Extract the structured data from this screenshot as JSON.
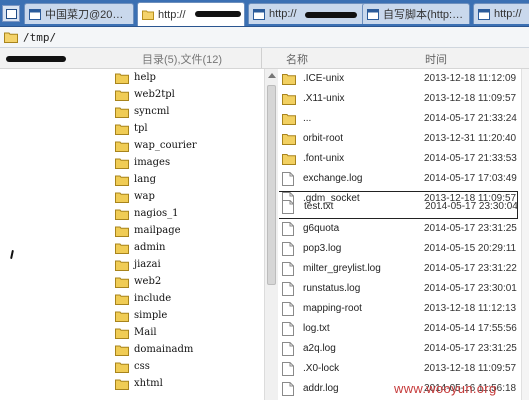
{
  "tabs": [
    {
      "label": "中国菜刀@20…",
      "active": false,
      "icon": "app-window-icon"
    },
    {
      "label": "http://",
      "active": true,
      "icon": "folder-icon"
    },
    {
      "label": "http://",
      "active": false,
      "icon": "app-window-icon"
    },
    {
      "label": "自写脚本(http:…",
      "active": false,
      "icon": "app-window-icon"
    },
    {
      "label": "http://",
      "active": false,
      "icon": "app-window-icon"
    }
  ],
  "path": {
    "value": "/tmp/"
  },
  "header": {
    "dir_count": "目录(5),文件(12)",
    "col_name": "名称",
    "col_time": "时间"
  },
  "tree": [
    {
      "label": "help"
    },
    {
      "label": "web2tpl"
    },
    {
      "label": "syncml"
    },
    {
      "label": "tpl"
    },
    {
      "label": "wap_courier"
    },
    {
      "label": "images"
    },
    {
      "label": "lang"
    },
    {
      "label": "wap"
    },
    {
      "label": "nagios_1"
    },
    {
      "label": "mailpage"
    },
    {
      "label": "admin"
    },
    {
      "label": "jiazai"
    },
    {
      "label": "web2"
    },
    {
      "label": "include"
    },
    {
      "label": "simple"
    },
    {
      "label": "Mail"
    },
    {
      "label": "domainadm"
    },
    {
      "label": "css"
    },
    {
      "label": "xhtml"
    }
  ],
  "files": [
    {
      "name": ".ICE-unix",
      "time": "2013-12-18 11:12:09",
      "type": "folder"
    },
    {
      "name": ".X11-unix",
      "time": "2013-12-18 11:09:57",
      "type": "folder"
    },
    {
      "name": "...",
      "time": "2014-05-17 21:33:24",
      "type": "folder"
    },
    {
      "name": "orbit-root",
      "time": "2013-12-31 11:20:40",
      "type": "folder"
    },
    {
      "name": ".font-unix",
      "time": "2014-05-17 21:33:53",
      "type": "folder"
    },
    {
      "name": "exchange.log",
      "time": "2014-05-17 17:03:49",
      "type": "file"
    },
    {
      "name": ".gdm_socket",
      "time": "2013-12-18 11:09:57",
      "type": "file"
    },
    {
      "name": "test.txt",
      "time": "2014-05-17 23:30:04",
      "type": "file",
      "selected": true
    },
    {
      "name": "g6quota",
      "time": "2014-05-17 23:31:25",
      "type": "file"
    },
    {
      "name": "pop3.log",
      "time": "2014-05-15 20:29:11",
      "type": "file"
    },
    {
      "name": "milter_greylist.log",
      "time": "2014-05-17 23:31:22",
      "type": "file"
    },
    {
      "name": "runstatus.log",
      "time": "2014-05-17 23:30:01",
      "type": "file"
    },
    {
      "name": "mapping-root",
      "time": "2013-12-18 11:12:13",
      "type": "file"
    },
    {
      "name": "log.txt",
      "time": "2014-05-14 17:55:56",
      "type": "file"
    },
    {
      "name": "a2q.log",
      "time": "2014-05-17 23:31:25",
      "type": "file"
    },
    {
      "name": ".X0-lock",
      "time": "2013-12-18 11:09:57",
      "type": "file"
    },
    {
      "name": "addr.log",
      "time": "2014-05-16 11:56:18",
      "type": "file"
    }
  ],
  "watermark": "www.wooyun.org",
  "colors": {
    "tabbar": "#3b70b3",
    "folder": "#e9c04a",
    "selection_border": "#222222",
    "watermark": "#c63a3a"
  }
}
